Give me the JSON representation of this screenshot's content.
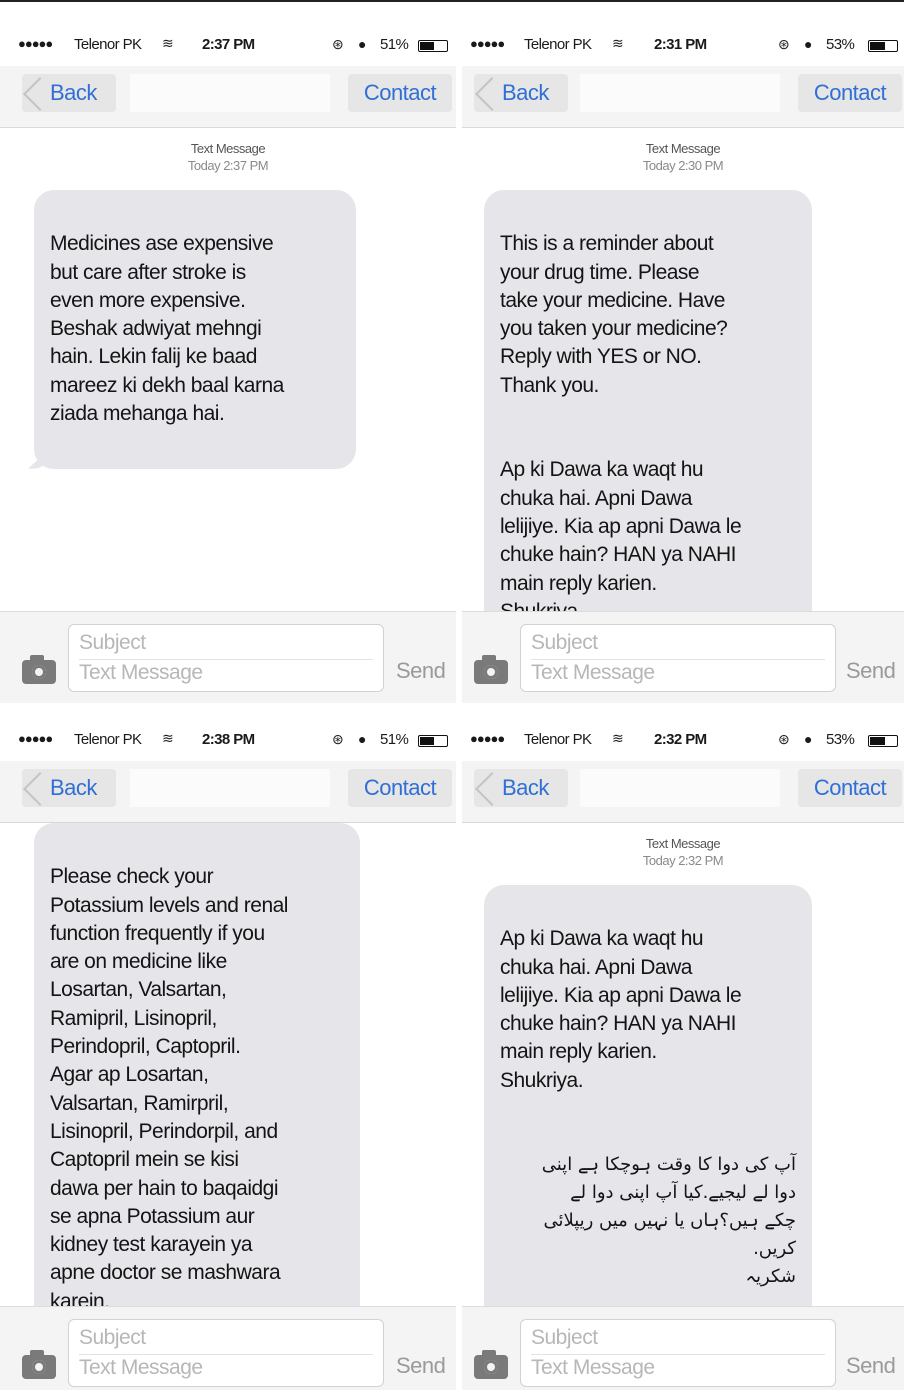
{
  "screens": [
    {
      "status": {
        "signal": "●●●●●",
        "carrier": "Telenor PK",
        "wifi_icon": "wifi-icon",
        "time": "2:37 PM",
        "battery_pct": "51%",
        "battery_level": 0.51
      },
      "nav": {
        "back": "Back",
        "contact": "Contact"
      },
      "meta": {
        "label": "Text Message",
        "when": "Today 2:37 PM"
      },
      "message": {
        "text": "Medicines ase expensive\nbut care after stroke is\neven more expensive.\nBeshak adwiyat mehngi\nhain. Lekin falij ke baad\nmareez ki dekh baal karna\nziada mehanga hai."
      },
      "composer": {
        "subject": "Subject",
        "text": "Text Message",
        "send": "Send",
        "camera_icon": "camera-icon"
      }
    },
    {
      "status": {
        "signal": "●●●●●",
        "carrier": "Telenor PK",
        "wifi_icon": "wifi-icon",
        "time": "2:31 PM",
        "battery_pct": "53%",
        "battery_level": 0.53
      },
      "nav": {
        "back": "Back",
        "contact": "Contact"
      },
      "meta": {
        "label": "Text Message",
        "when": "Today 2:30 PM"
      },
      "message": {
        "text": "This is a reminder about\nyour drug time. Please\ntake your medicine. Have\nyou taken your medicine?\nReply with YES or NO.\nThank you.",
        "text2": "Ap ki Dawa ka waqt hu\nchuka hai. Apni Dawa\nlelijiye. Kia ap apni Dawa le\nchuke hain? HAN ya NAHI\nmain reply karien.\nShukriya."
      },
      "composer": {
        "subject": "Subject",
        "text": "Text Message",
        "send": "Send",
        "camera_icon": "camera-icon"
      }
    },
    {
      "status": {
        "signal": "●●●●●",
        "carrier": "Telenor PK",
        "wifi_icon": "wifi-icon",
        "time": "2:38 PM",
        "battery_pct": "51%",
        "battery_level": 0.51
      },
      "nav": {
        "back": "Back",
        "contact": "Contact"
      },
      "message": {
        "text": "Please check your\nPotassium levels and renal\nfunction frequently if you\nare on medicine like\nLosartan, Valsartan,\nRamipril, Lisinopril,\nPerindopril, Captopril.\nAgar ap Losartan,\nValsartan, Ramirpril,\nLisinopril, Perindorpil, and\nCaptopril mein se kisi\ndawa per hain to baqaidgi\nse apna Potassium aur\nkidney test karayein ya\napne doctor se mashwara\nkarein."
      },
      "composer": {
        "subject": "Subject",
        "text": "Text Message",
        "send": "Send",
        "camera_icon": "camera-icon"
      }
    },
    {
      "status": {
        "signal": "●●●●●",
        "carrier": "Telenor PK",
        "wifi_icon": "wifi-icon",
        "time": "2:32 PM",
        "battery_pct": "53%",
        "battery_level": 0.53
      },
      "nav": {
        "back": "Back",
        "contact": "Contact"
      },
      "meta": {
        "label": "Text Message",
        "when": "Today 2:32 PM"
      },
      "message": {
        "text": "Ap ki Dawa ka waqt hu\nchuka hai. Apni Dawa\nlelijiye. Kia ap apni Dawa le\nchuke hain? HAN ya NAHI\nmain reply karien.\nShukriya.",
        "urdu": "آپ کی دوا کا وقت ہوچکا ہے اپنی\nدوا لے لیجیے.کیا آپ اپنی دوا لے\nچکے ہیں؟ہاں یا نہیں میں ریپلائی\nکریں.\nشکریہ"
      },
      "composer": {
        "subject": "Subject",
        "text": "Text Message",
        "send": "Send",
        "camera_icon": "camera-icon"
      }
    }
  ]
}
